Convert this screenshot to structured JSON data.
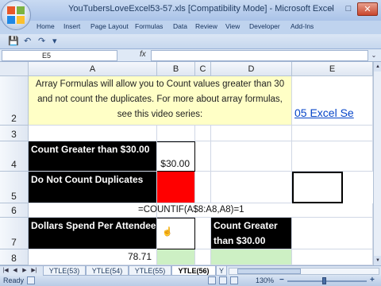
{
  "window": {
    "title": "YouTubersLoveExcel53-57.xls  [Compatibility Mode]  -  Microsoft Excel",
    "min": "–",
    "max": "□",
    "close": "✕"
  },
  "ribbon_tabs": [
    "Home",
    "Insert",
    "Page Layout",
    "Formulas",
    "Data",
    "Review",
    "View",
    "Developer",
    "Add-Ins"
  ],
  "qat": {
    "save": "💾",
    "undo": "↶",
    "redo": "↷",
    "more": "▾"
  },
  "formula_bar": {
    "name_box": "E5",
    "fx": "fx",
    "formula": "",
    "expand": "⌄"
  },
  "columns": [
    "A",
    "B",
    "C",
    "D",
    "E"
  ],
  "rows": [
    "2",
    "3",
    "4",
    "5",
    "6",
    "7",
    "8"
  ],
  "cells": {
    "note": "Array Formulas will allow you to Count values greater than 30 and not count the duplicates. For more about array formulas, see this video series:",
    "link": "05 Excel Se",
    "a4": "Count Greater than $30.00",
    "b4": "$30.00",
    "a5": "Do Not Count Duplicates",
    "b6": "=COUNTIF(A$8:A8,A8)=1",
    "a7": "Dollars Spend Per Attendee",
    "d7": "Count Greater than $30.00",
    "a8": "78.71"
  },
  "sheet_tabs": [
    "YTLE(53)",
    "YTLE(54)",
    "YTLE(55)",
    "YTLE(56)",
    "Y"
  ],
  "active_sheet": "YTLE(56)",
  "status": {
    "ready": "Ready",
    "zoom": "130%",
    "zoom_out": "−",
    "zoom_in": "+"
  },
  "colors": {
    "red": "#ff0000",
    "black": "#000000",
    "note_yellow": "#ffffc6",
    "green": "#cdf0c4",
    "link": "#0645c8"
  }
}
